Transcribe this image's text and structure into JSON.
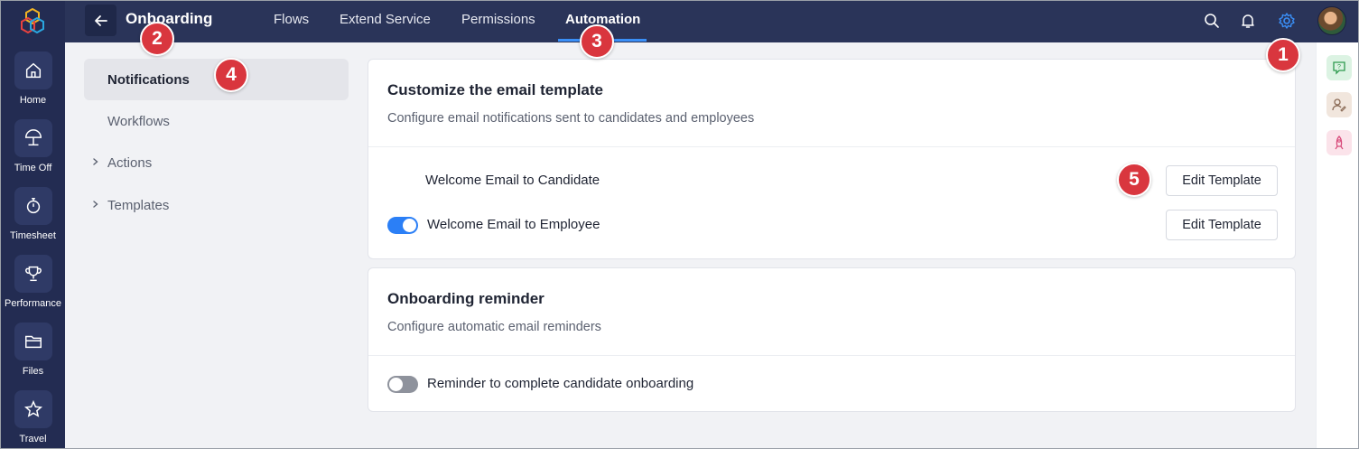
{
  "header": {
    "title": "Onboarding",
    "tabs": [
      {
        "label": "Flows"
      },
      {
        "label": "Extend Service"
      },
      {
        "label": "Permissions"
      },
      {
        "label": "Automation",
        "active": true
      }
    ]
  },
  "rail": {
    "items": [
      {
        "label": "Home",
        "icon": "home-icon"
      },
      {
        "label": "Time Off",
        "icon": "beach-umbrella-icon"
      },
      {
        "label": "Timesheet",
        "icon": "stopwatch-icon"
      },
      {
        "label": "Performance",
        "icon": "trophy-icon"
      },
      {
        "label": "Files",
        "icon": "folder-icon"
      },
      {
        "label": "Travel",
        "icon": "star-icon"
      }
    ]
  },
  "subnav": {
    "items": [
      {
        "label": "Notifications",
        "active": true
      },
      {
        "label": "Workflows"
      },
      {
        "label": "Actions",
        "expandable": true
      },
      {
        "label": "Templates",
        "expandable": true
      }
    ]
  },
  "email_card": {
    "title": "Customize the email template",
    "description": "Configure email notifications sent to candidates and employees",
    "rows": [
      {
        "label": "Welcome Email to Candidate",
        "button": "Edit Template",
        "toggle": null
      },
      {
        "label": "Welcome Email to Employee",
        "button": "Edit Template",
        "toggle": "on"
      }
    ]
  },
  "reminder_card": {
    "title": "Onboarding reminder",
    "description": "Configure automatic email reminders",
    "rows": [
      {
        "label": "Reminder to complete candidate onboarding",
        "toggle": "off"
      }
    ]
  },
  "callouts": [
    "1",
    "2",
    "3",
    "4",
    "5"
  ],
  "colors": {
    "rail_bg": "#232c52",
    "topbar_bg": "#2a3459",
    "accent": "#2b7ff6",
    "callout": "#d9363e"
  }
}
